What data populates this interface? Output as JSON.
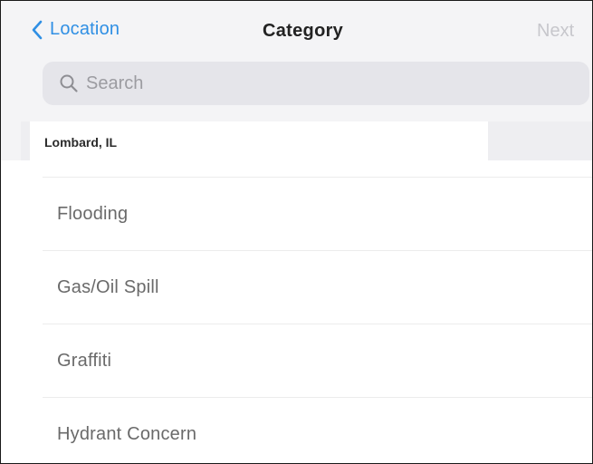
{
  "nav": {
    "back_label": "Location",
    "title": "Category",
    "next_label": "Next"
  },
  "search": {
    "placeholder": "Search",
    "value": ""
  },
  "location": {
    "label": "Lombard, IL"
  },
  "categories": [
    {
      "label": "Flooding"
    },
    {
      "label": "Gas/Oil Spill"
    },
    {
      "label": "Graffiti"
    },
    {
      "label": "Hydrant Concern"
    }
  ],
  "colors": {
    "accent": "#2f8fe4",
    "disabled": "#c7c7cc",
    "search_bg": "#e5e5ea"
  },
  "icons": {
    "back": "chevron-left-icon",
    "search": "search-icon"
  }
}
